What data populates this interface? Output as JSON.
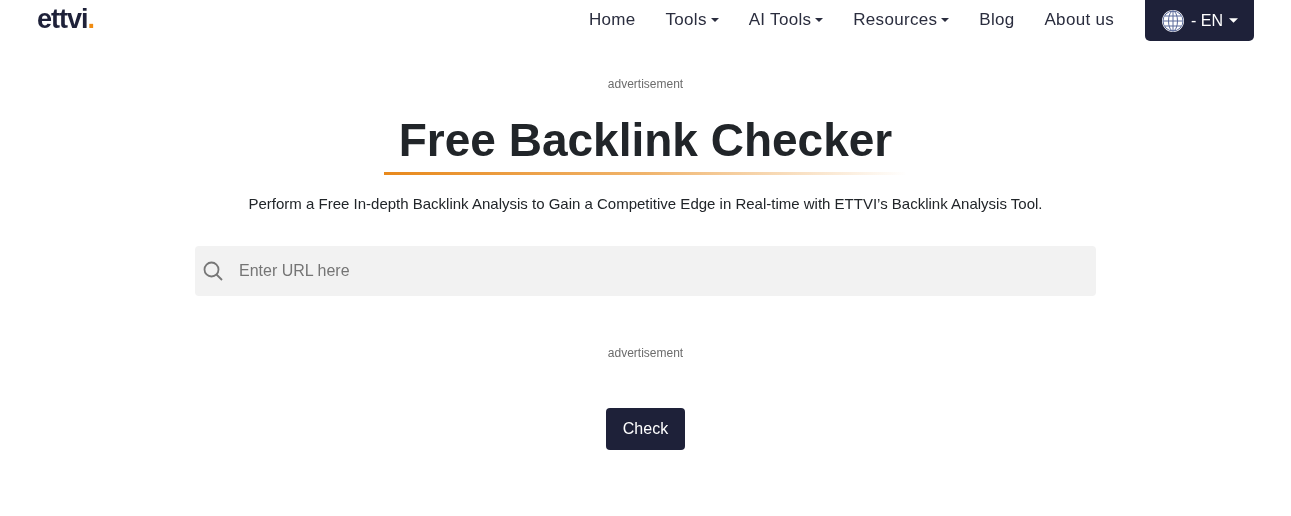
{
  "logo": {
    "text": "ettvi",
    "dot": "."
  },
  "nav": [
    {
      "label": "Home",
      "dropdown": false
    },
    {
      "label": "Tools",
      "dropdown": true
    },
    {
      "label": "AI Tools",
      "dropdown": true
    },
    {
      "label": "Resources",
      "dropdown": true
    },
    {
      "label": "Blog",
      "dropdown": false
    },
    {
      "label": "About us",
      "dropdown": false
    }
  ],
  "language_button": {
    "label": "- EN"
  },
  "ad_top": "advertisement",
  "title": "Free Backlink Checker",
  "subtitle": "Perform a Free In-depth Backlink Analysis to Gain a Competitive Edge in Real-time with ETTVI’s Backlink Analysis Tool.",
  "search": {
    "placeholder": "Enter URL here"
  },
  "ad_bottom": "advertisement",
  "check_button": "Check"
}
